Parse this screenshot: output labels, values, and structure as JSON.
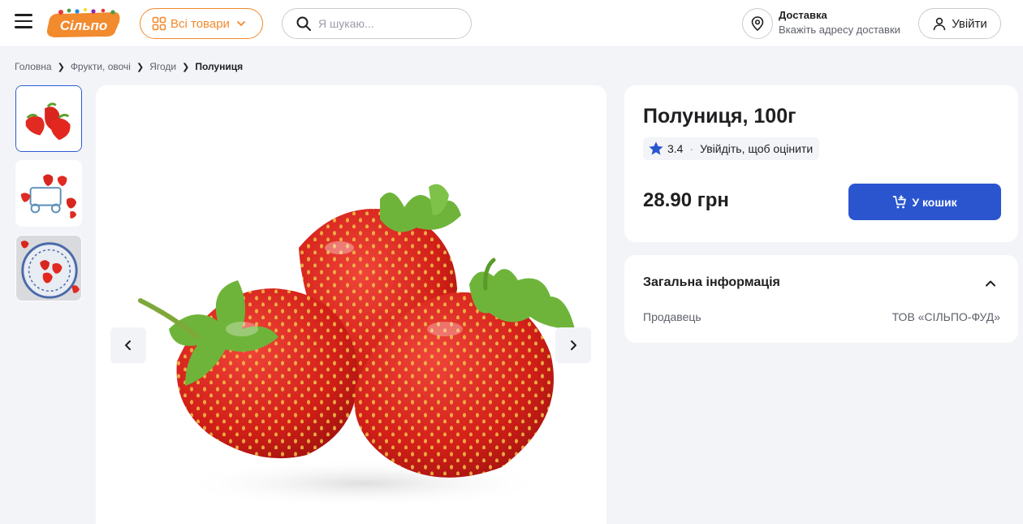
{
  "header": {
    "logo_text": "Сільпо",
    "catalog_label": "Всі товари",
    "search_placeholder": "Я шукаю...",
    "delivery_title": "Доставка",
    "delivery_subtitle": "Вкажіть адресу доставки",
    "login_label": "Увійти"
  },
  "breadcrumb": {
    "items": [
      "Головна",
      "Фрукти, овочі",
      "Ягоди"
    ],
    "current": "Полуниця"
  },
  "gallery": {
    "thumbnails": [
      "strawberries-white",
      "strawberries-cart",
      "strawberries-plate"
    ],
    "active_index": 0
  },
  "product": {
    "title": "Полуниця, 100г",
    "rating": "3.4",
    "rate_prompt": "Увійдіть, щоб оцінити",
    "price": "28.90 грн",
    "cart_label": "У кошик"
  },
  "info": {
    "title": "Загальна інформація",
    "seller_label": "Продавець",
    "seller_value": "ТОВ «СІЛЬПО-ФУД»"
  },
  "colors": {
    "accent_orange": "#f28a2e",
    "primary_blue": "#2a55cf",
    "background": "#f3f4f8"
  }
}
